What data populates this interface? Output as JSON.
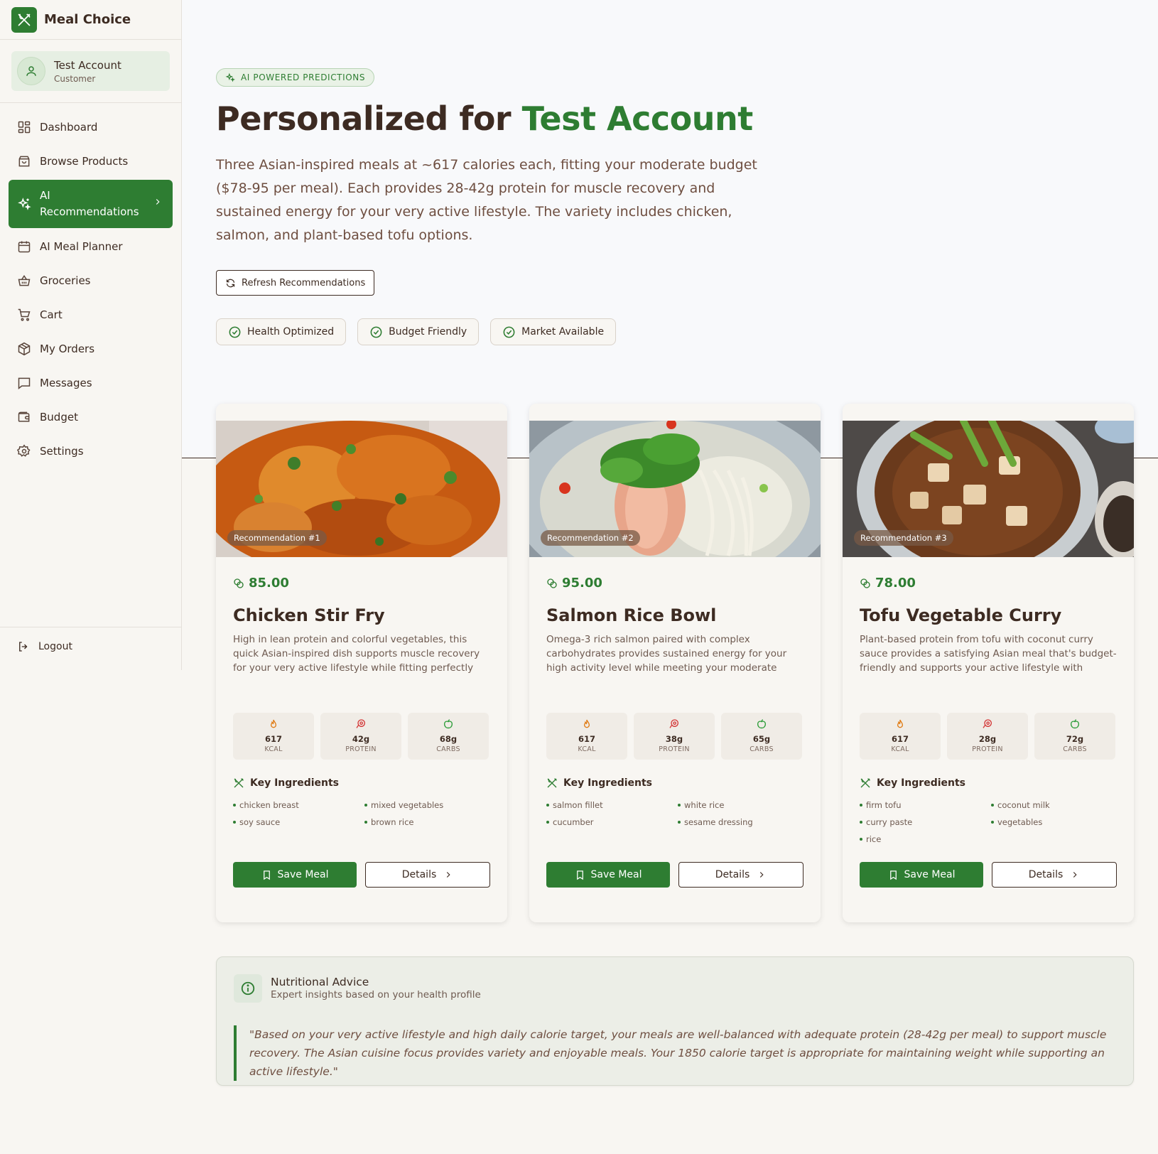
{
  "brand": {
    "name": "Meal Choice"
  },
  "user": {
    "name": "Test Account",
    "role": "Customer"
  },
  "nav": {
    "items": [
      {
        "label": "Dashboard",
        "icon": "grid-icon"
      },
      {
        "label": "Browse Products",
        "icon": "shopping-bag-icon"
      },
      {
        "label": "AI Recommendations",
        "icon": "sparkles-icon",
        "active": true
      },
      {
        "label": "AI Meal Planner",
        "icon": "calendar-icon"
      },
      {
        "label": "Groceries",
        "icon": "basket-icon"
      },
      {
        "label": "Cart",
        "icon": "cart-icon"
      },
      {
        "label": "My Orders",
        "icon": "package-icon"
      },
      {
        "label": "Messages",
        "icon": "message-square-icon"
      },
      {
        "label": "Budget",
        "icon": "wallet-icon"
      },
      {
        "label": "Settings",
        "icon": "gear-icon"
      }
    ],
    "logout": "Logout"
  },
  "hero": {
    "badge": "AI POWERED PREDICTIONS",
    "title_prefix": "Personalized for ",
    "title_name": "Test Account",
    "description": "Three Asian-inspired meals at ~617 calories each, fitting your moderate budget ($78-95 per meal). Each provides 28-42g protein for muscle recovery and sustained energy for your very active lifestyle. The variety includes chicken, salmon, and plant-based tofu options.",
    "refresh_label": "Refresh Recommendations",
    "chips": [
      "Health Optimized",
      "Budget Friendly",
      "Market Available"
    ]
  },
  "colors": {
    "accent": "#2e7d32",
    "text": "#3d2b22",
    "muted": "#6e4e40"
  },
  "meals": [
    {
      "tag": "Recommendation #1",
      "price": "85.00",
      "title": "Chicken Stir Fry",
      "description": "High in lean protein and colorful vegetables, this quick Asian-inspired dish supports muscle recovery for your very active lifestyle while fitting perfectly within your calorie target.",
      "kcal": "617",
      "protein": "42g",
      "carbs": "68g",
      "ingredients": [
        "chicken breast",
        "mixed vegetables",
        "soy sauce",
        "brown rice"
      ]
    },
    {
      "tag": "Recommendation #2",
      "price": "95.00",
      "title": "Salmon Rice Bowl",
      "description": "Omega-3 rich salmon paired with complex carbohydrates provides sustained energy for your high activity level while meeting your moderate budget and calorie needs.",
      "kcal": "617",
      "protein": "38g",
      "carbs": "65g",
      "ingredients": [
        "salmon fillet",
        "white rice",
        "cucumber",
        "sesame dressing"
      ]
    },
    {
      "tag": "Recommendation #3",
      "price": "78.00",
      "title": "Tofu Vegetable Curry",
      "description": "Plant-based protein from tofu with coconut curry sauce provides a satisfying Asian meal that's budget-friendly and supports your active lifestyle with sustained energy.",
      "kcal": "617",
      "protein": "28g",
      "carbs": "72g",
      "ingredients": [
        "firm tofu",
        "coconut milk",
        "curry paste",
        "vegetables",
        "rice"
      ]
    }
  ],
  "card_labels": {
    "kcal": "KCAL",
    "protein": "PROTEIN",
    "carbs": "CARBS",
    "ingredients_heading": "Key Ingredients",
    "save": "Save Meal",
    "details": "Details"
  },
  "advice": {
    "title": "Nutritional Advice",
    "subtitle": "Expert insights based on your health profile",
    "quote": "\"Based on your very active lifestyle and high daily calorie target, your meals are well-balanced with adequate protein (28-42g per meal) to support muscle recovery. The Asian cuisine focus provides variety and enjoyable meals. Your 1850 calorie target is appropriate for maintaining weight while supporting an active lifestyle.\""
  }
}
